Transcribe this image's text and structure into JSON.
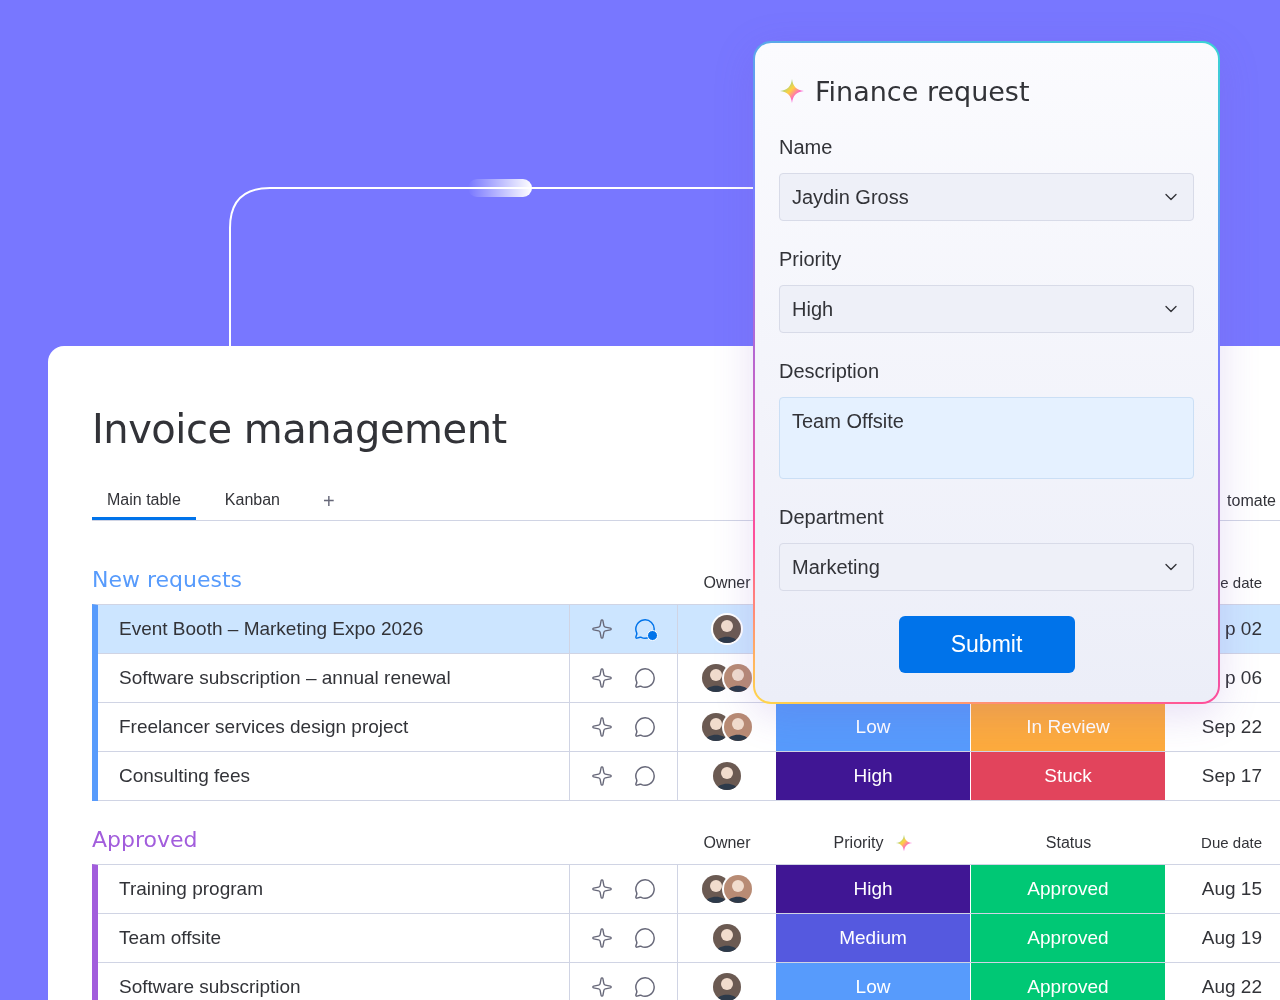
{
  "board": {
    "title": "Invoice management",
    "tabs": [
      {
        "label": "Main table",
        "selected": true
      },
      {
        "label": "Kanban",
        "selected": false
      }
    ],
    "add_tab": "+",
    "toolbar_item": "tomate",
    "groups": [
      {
        "title": "New requests",
        "color": "#579bfc",
        "columns": [
          {
            "label": "Owner",
            "ai": false
          },
          null,
          null,
          {
            "label": "e date",
            "ai": false
          }
        ],
        "rows": [
          {
            "name": "Event Booth – Marketing Expo 2026",
            "selected": true,
            "comment_unread": true,
            "owners": [
              {
                "kind": "photo"
              }
            ],
            "priority": null,
            "status": null,
            "due": "p 02"
          },
          {
            "name": "Software subscription – annual renewal",
            "selected": false,
            "comment_unread": false,
            "owners": [
              {
                "kind": "photo"
              },
              {
                "kind": "photo"
              }
            ],
            "priority": null,
            "status": null,
            "due": "p 06"
          },
          {
            "name": "Freelancer services design project",
            "selected": false,
            "comment_unread": false,
            "owners": [
              {
                "kind": "photo"
              },
              {
                "kind": "photo"
              }
            ],
            "priority": {
              "label": "Low",
              "color": "#579bfc"
            },
            "status": {
              "label": "In Review",
              "color": "#fdab3d"
            },
            "due": "Sep 22"
          },
          {
            "name": "Consulting fees",
            "selected": false,
            "comment_unread": false,
            "owners": [
              {
                "kind": "photo"
              }
            ],
            "priority": {
              "label": "High",
              "color": "#401694"
            },
            "status": {
              "label": "Stuck",
              "color": "#e2445c"
            },
            "due": "Sep 17"
          }
        ]
      },
      {
        "title": "Approved",
        "color": "#a25ddc",
        "columns": [
          {
            "label": "Owner",
            "ai": false
          },
          {
            "label": "Priority",
            "ai": true
          },
          {
            "label": "Status",
            "ai": false
          },
          {
            "label": "Due date",
            "ai": false
          }
        ],
        "rows": [
          {
            "name": "Training program",
            "selected": false,
            "comment_unread": false,
            "owners": [
              {
                "kind": "photo"
              },
              {
                "kind": "photo"
              }
            ],
            "priority": {
              "label": "High",
              "color": "#401694"
            },
            "status": {
              "label": "Approved",
              "color": "#00c875"
            },
            "due": "Aug 15"
          },
          {
            "name": "Team offsite",
            "selected": false,
            "comment_unread": false,
            "owners": [
              {
                "kind": "photo"
              }
            ],
            "priority": {
              "label": "Medium",
              "color": "#5559df"
            },
            "status": {
              "label": "Approved",
              "color": "#00c875"
            },
            "due": "Aug 19"
          },
          {
            "name": "Software subscription",
            "selected": false,
            "comment_unread": false,
            "owners": [
              {
                "kind": "photo"
              }
            ],
            "priority": {
              "label": "Low",
              "color": "#579bfc"
            },
            "status": {
              "label": "Approved",
              "color": "#00c875"
            },
            "due": "Aug 22"
          }
        ]
      }
    ]
  },
  "form": {
    "title": "Finance request",
    "fields": [
      {
        "label": "Name",
        "kind": "select",
        "value": "Jaydin Gross"
      },
      {
        "label": "Priority",
        "kind": "select",
        "value": "High"
      },
      {
        "label": "Description",
        "kind": "textarea",
        "value": "Team Offsite"
      },
      {
        "label": "Department",
        "kind": "select",
        "value": "Marketing"
      }
    ],
    "submit": "Submit"
  }
}
